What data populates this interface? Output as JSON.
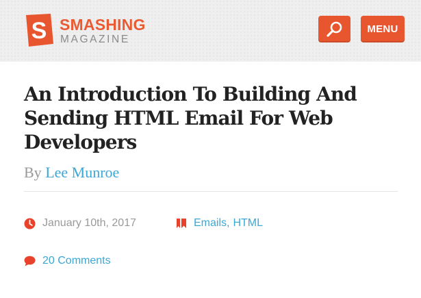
{
  "header": {
    "logo": {
      "name": "SMASHING",
      "sub": "MAGAZINE",
      "mark_letter": "S"
    },
    "search_icon": "search-icon",
    "menu_label": "MENU"
  },
  "article": {
    "title": "An Introduction To Building And Sending HTML Email For Web Developers",
    "byline_prefix": "By",
    "author": "Lee Munroe",
    "date": "January 10th, 2017",
    "tags": [
      "Emails",
      "HTML"
    ],
    "tag_separator": ",",
    "comments": "20 Comments"
  },
  "colors": {
    "brand_orange": "#e8562f",
    "link_blue": "#3aa7d6",
    "meta_red": "#e8412c"
  },
  "icons": {
    "date": "clock-icon",
    "tags": "bookmark-icon",
    "comments": "comment-bubble-icon"
  }
}
